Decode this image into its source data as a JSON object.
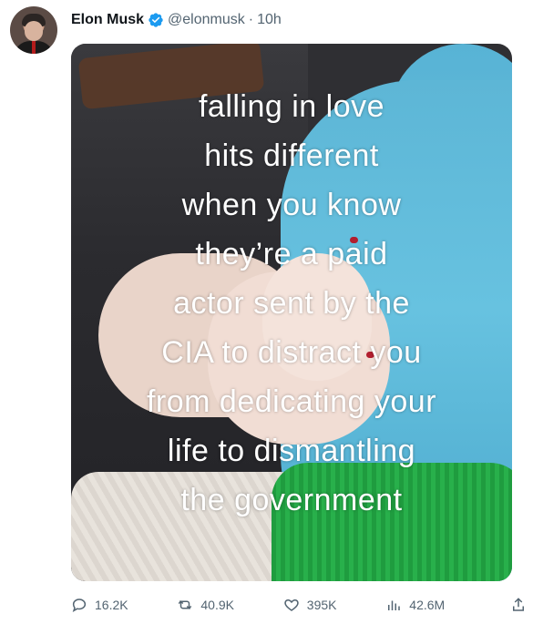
{
  "author": {
    "name": "Elon Musk",
    "handle": "@elonmusk",
    "separator": "·",
    "time": "10h",
    "verified": true
  },
  "media": {
    "overlay_lines": [
      "falling in love",
      "hits different",
      "when you know",
      "they’re a paid",
      "actor sent by the",
      "CIA to distract you",
      "from dedicating your",
      "life to dismantling",
      "the government"
    ]
  },
  "actions": {
    "replies": "16.2K",
    "reposts": "40.9K",
    "likes": "395K",
    "views": "42.6M"
  },
  "colors": {
    "text_primary": "#0f1419",
    "text_secondary": "#536471",
    "verified_blue": "#1d9bf0"
  },
  "icons": {
    "verified": "verified-badge-icon",
    "reply": "reply-icon",
    "repost": "repost-icon",
    "like": "heart-icon",
    "views": "views-chart-icon",
    "share": "share-icon"
  }
}
